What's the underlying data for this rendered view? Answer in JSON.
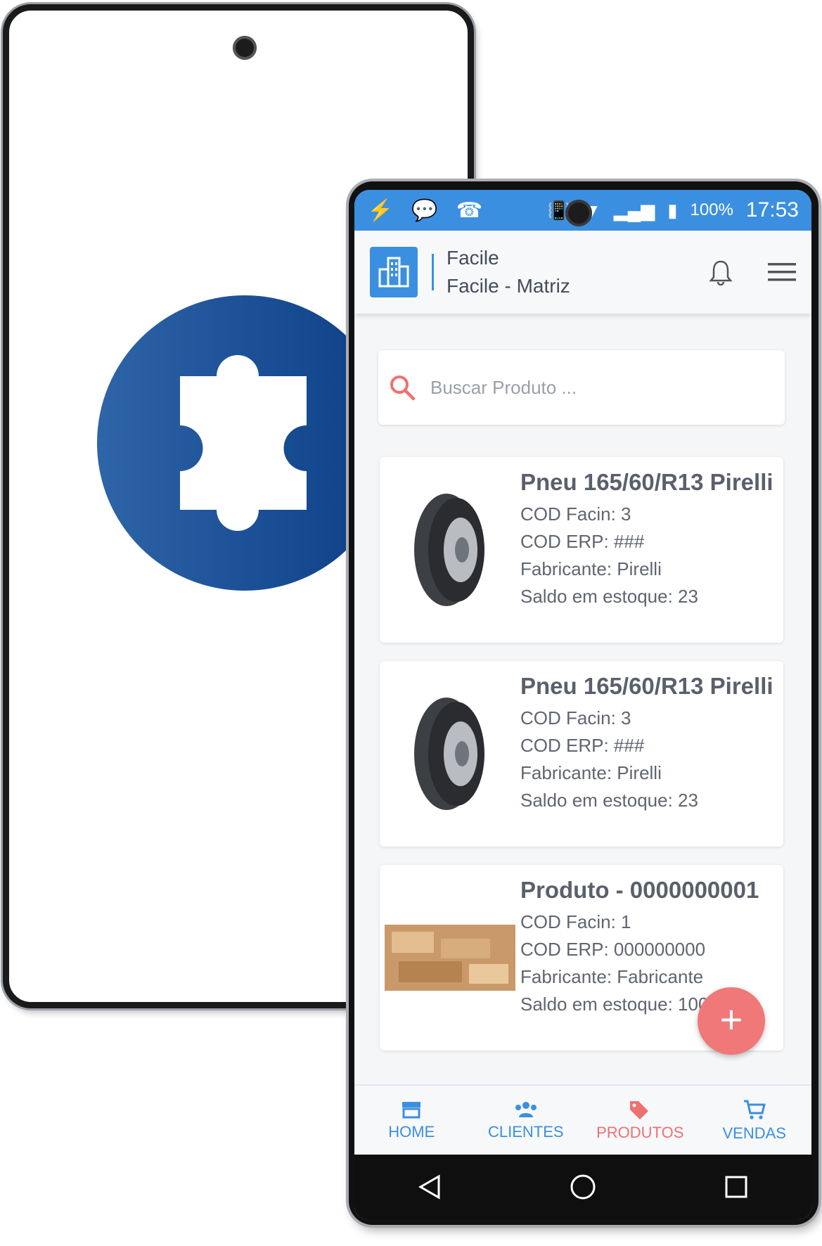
{
  "status_bar": {
    "battery": "100%",
    "time": "17:53"
  },
  "header": {
    "company": "Facile",
    "branch": "Facile - Matriz"
  },
  "search": {
    "placeholder": "Buscar Produto ..."
  },
  "products": [
    {
      "name": "Pneu 165/60/R13 Pirelli",
      "cod_facin": "COD Facin: 3",
      "cod_erp": "COD ERP: ###",
      "fabricante": "Fabricante: Pirelli",
      "saldo": "Saldo em estoque: 23",
      "image": "tire"
    },
    {
      "name": "Pneu 165/60/R13 Pirelli",
      "cod_facin": "COD Facin: 3",
      "cod_erp": "COD ERP: ###",
      "fabricante": "Fabricante: Pirelli",
      "saldo": "Saldo em estoque: 23",
      "image": "tire"
    },
    {
      "name": "Produto - 0000000001",
      "cod_facin": "COD Facin: 1",
      "cod_erp": "COD ERP: 000000000",
      "fabricante": "Fabricante: Fabricante",
      "saldo": "Saldo em estoque: 100",
      "image": "wood"
    }
  ],
  "fab": {
    "label": "+"
  },
  "nav": [
    {
      "label": "HOME",
      "icon": "store-icon"
    },
    {
      "label": "CLIENTES",
      "icon": "people-icon"
    },
    {
      "label": "PRODUTOS",
      "icon": "tags-icon"
    },
    {
      "label": "VENDAS",
      "icon": "cart-icon"
    }
  ],
  "colors": {
    "primary": "#3b8fe0",
    "accent": "#f07070",
    "puzzle_blue": "#1f5aa6"
  }
}
